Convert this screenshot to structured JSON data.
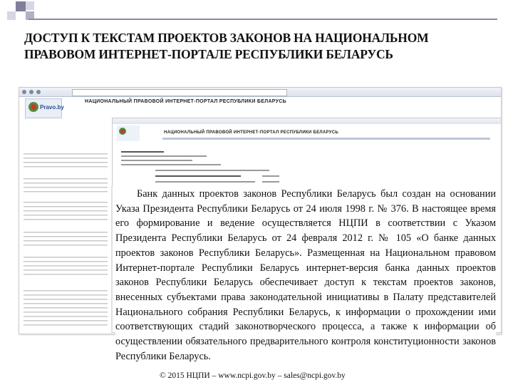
{
  "slide": {
    "title": "ДОСТУП К ТЕКСТАМ ПРОЕКТОВ ЗАКОНОВ НА НАЦИОНАЛЬНОМ ПРАВОВОМ ИНТЕРНЕТ-ПОРТАЛЕ РЕСПУБЛИКИ БЕЛАРУСЬ",
    "body": "Банк данных проектов законов Республики Беларусь был создан на основании Указа Президента Республики Беларусь от 24 июля 1998 г. № 376. В настоящее время его формирование и ведение осуществляется НЦПИ в соответствии с Указом Президента Республики Беларусь от 24 февраля 2012 г. № 105 «О банке данных проектов законов Республики Беларусь». Размещенная на Национальном правовом Интернет-портале Республики Беларусь интернет-версия банка данных проектов законов Республики Беларусь обеспечивает доступ к текстам проектов законов, внесенных субъектами права законодательной инициативы в Палату представителей Национального собрания Республики Беларусь, к информации о прохождении ими соответствующих стадий законотворческого процесса, а также к информации об осуществлении обязательного предварительного контроля конституционности законов Республики Беларусь.",
    "footer": "© 2015 НЦПИ – www.ncpi.gov.by – sales@ncpi.gov.by"
  },
  "screenshot": {
    "logo_text": "Pravo.by",
    "portal_title": "НАЦИОНАЛЬНЫЙ ПРАВОВОЙ ИНТЕРНЕТ-ПОРТАЛ РЕСПУБЛИКИ БЕЛАРУСЬ",
    "colors": {
      "emblem_green": "#4f8f3a",
      "emblem_red": "#c23a2e",
      "link_blue": "#3355aa"
    }
  }
}
